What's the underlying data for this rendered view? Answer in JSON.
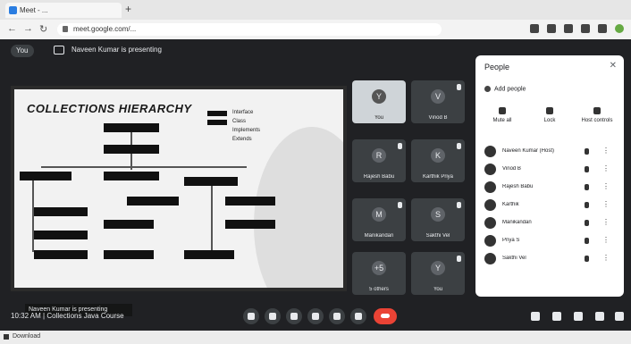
{
  "browser": {
    "tab_title": "Meet - ...",
    "url": "meet.google.com/...",
    "new_tab": "+"
  },
  "meeting": {
    "host_label": "You",
    "presenting_text": "Naveen Kumar is presenting",
    "time_label": "10:32 AM",
    "meeting_name": "Collections Java Course"
  },
  "slide": {
    "title": "COLLECTIONS HIERARCHY",
    "legend": [
      "Interface",
      "Class",
      "Implements",
      "Extends"
    ],
    "caption": "Naveen Kumar is presenting"
  },
  "participants": [
    {
      "name": "You",
      "initial": "Y"
    },
    {
      "name": "Vinod B",
      "initial": "V"
    },
    {
      "name": "Rajesh Babu",
      "initial": "R"
    },
    {
      "name": "Karthik Priya",
      "initial": "K"
    },
    {
      "name": "Manikandan",
      "initial": "M"
    },
    {
      "name": "Sakthi Vel",
      "initial": "S"
    },
    {
      "name": "5 others",
      "initial": "+5"
    },
    {
      "name": "You",
      "initial": "Y"
    }
  ],
  "panel": {
    "title": "People",
    "close_icon": "close-icon",
    "add_people": "Add people",
    "actions": [
      "Mute all",
      "Lock",
      "Host controls"
    ],
    "people": [
      {
        "name": "Naveen Kumar (Host)"
      },
      {
        "name": "Vinod B"
      },
      {
        "name": "Rajesh Babu"
      },
      {
        "name": "Karthik"
      },
      {
        "name": "Manikandan"
      },
      {
        "name": "Priya S"
      },
      {
        "name": "Sakthi Vel"
      }
    ]
  },
  "footer": {
    "text": "Download"
  },
  "colors": {
    "app_bg": "#202124",
    "tile_bg": "#3c4043",
    "end_call": "#ea4335"
  }
}
